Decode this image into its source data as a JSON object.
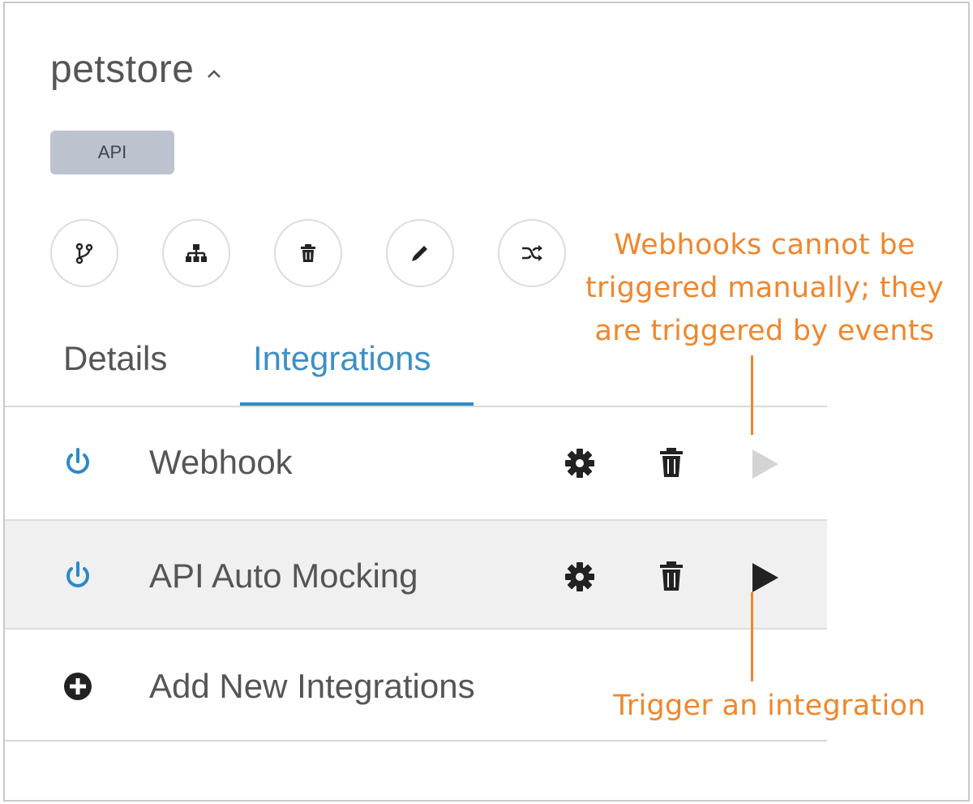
{
  "header": {
    "api_name": "petstore",
    "badge": "API"
  },
  "actions": [
    {
      "icon": "branch-icon"
    },
    {
      "icon": "sitemap-icon"
    },
    {
      "icon": "trash-icon"
    },
    {
      "icon": "pencil-icon"
    },
    {
      "icon": "shuffle-icon"
    }
  ],
  "tabs": {
    "details": "Details",
    "integrations": "Integrations",
    "active": "integrations"
  },
  "integrations": {
    "rows": [
      {
        "label": "Webhook",
        "icon": "power-icon",
        "trigger_enabled": false
      },
      {
        "label": "API Auto Mocking",
        "icon": "power-icon",
        "trigger_enabled": true
      }
    ],
    "add_label": "Add New Integrations"
  },
  "annotations": {
    "top": "Webhooks cannot be triggered manually; they are triggered by events",
    "bottom": "Trigger an integration"
  },
  "colors": {
    "accent": "#2b8ac8",
    "annotation": "#f0862c",
    "badge_bg": "#bdc3ce",
    "row_highlight": "#f0f0f0"
  }
}
